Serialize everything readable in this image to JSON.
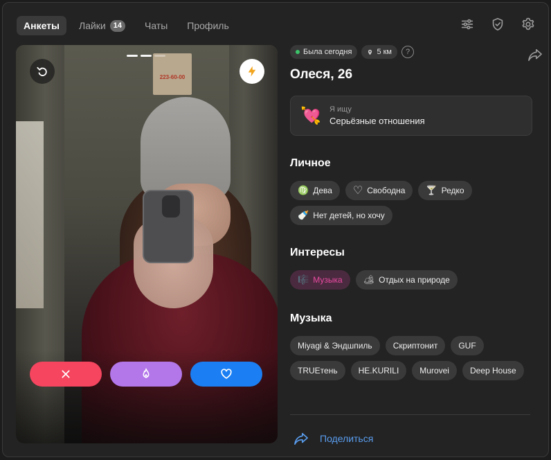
{
  "nav": {
    "tabs": [
      {
        "label": "Анкеты",
        "active": true
      },
      {
        "label": "Лайки",
        "badge": "14"
      },
      {
        "label": "Чаты"
      },
      {
        "label": "Профиль"
      }
    ],
    "icons": [
      "sliders-icon",
      "shield-check-icon",
      "gear-icon"
    ]
  },
  "photo": {
    "dots_total": 3,
    "dots_active": 2,
    "sign_text": "223-60-00",
    "actions": [
      "close-icon",
      "fire-icon",
      "heart-icon"
    ],
    "colors": {
      "dislike": "#f5455f",
      "superlike": "#b377ea",
      "like": "#1b7ff3"
    }
  },
  "profile": {
    "status": "Была сегодня",
    "distance": "5 км",
    "name_age": "Олеся, 26",
    "seeking": {
      "emoji": "💘",
      "title": "Я ищу",
      "value": "Серьёзные отношения"
    }
  },
  "personal": {
    "title": "Личное",
    "chips": [
      {
        "icon": "♍",
        "label": "Дева"
      },
      {
        "icon": "♡",
        "label": "Свободна"
      },
      {
        "icon": "🍸",
        "label": "Редко"
      },
      {
        "icon": "🍼",
        "label": "Нет детей, но хочу"
      }
    ]
  },
  "interests": {
    "title": "Интересы",
    "chips": [
      {
        "icon": "🎼",
        "label": "Музыка",
        "accent": "#e94ba1"
      },
      {
        "icon": "🏕",
        "label": "Отдых на природе"
      }
    ]
  },
  "music": {
    "title": "Музыка",
    "chips": [
      "Miyagi & Эндшпиль",
      "Скриптонит",
      "GUF",
      "TRUEтень",
      "HE.KURILI",
      "Murovei",
      "Deep House"
    ]
  },
  "share": {
    "label": "Поделиться"
  }
}
